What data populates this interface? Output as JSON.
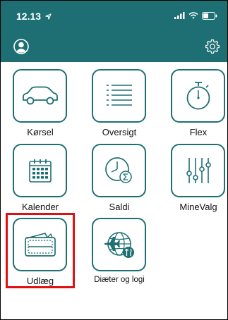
{
  "status_bar": {
    "time": "12.13",
    "location_icon": "location-arrow-icon",
    "signal_icon": "cellular-signal-icon",
    "wifi_icon": "wifi-icon",
    "battery_icon": "battery-icon"
  },
  "header": {
    "background": "#1e6f73",
    "profile_icon": "user-profile-icon",
    "settings_icon": "gear-icon"
  },
  "tiles": [
    {
      "label": "Kørsel",
      "icon": "car-icon"
    },
    {
      "label": "Oversigt",
      "icon": "list-icon"
    },
    {
      "label": "Flex",
      "icon": "stopwatch-icon"
    },
    {
      "label": "Kalender",
      "icon": "calendar-icon"
    },
    {
      "label": "Saldi",
      "icon": "clock-sum-icon"
    },
    {
      "label": "MineValg",
      "icon": "sliders-icon"
    },
    {
      "label": "Udlæg",
      "icon": "wallet-icon"
    },
    {
      "label": "Diæter og logi",
      "icon": "globe-plane-food-icon"
    }
  ],
  "colors": {
    "accent": "#1e6f73",
    "highlight": "#e01010"
  },
  "highlighted_tile": "Udlæg"
}
